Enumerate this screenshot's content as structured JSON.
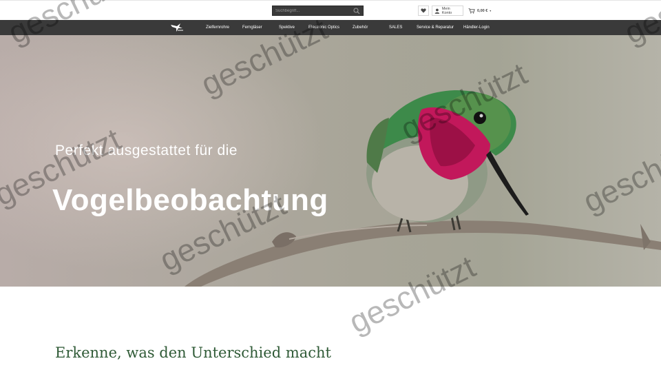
{
  "search": {
    "placeholder": "Suchbegriff..."
  },
  "header": {
    "account_label": "Mein Konto",
    "cart_total": "0,00 €",
    "cart_caret": "▾"
  },
  "nav": {
    "items": [
      {
        "label": "Zielfernrohre"
      },
      {
        "label": "Ferngläser"
      },
      {
        "label": "Spektive"
      },
      {
        "label": "Electronic Optics"
      },
      {
        "label": "Zubehör"
      },
      {
        "label": "SALES"
      },
      {
        "label": "Service & Reparatur"
      },
      {
        "label": "Händler-Login"
      }
    ]
  },
  "hero": {
    "subtitle": "Perfekt ausgestattet für die",
    "title": "Vogelbeobachtung"
  },
  "section": {
    "heading": "Erkenne, was den Unterschied macht"
  },
  "watermark": {
    "text": "geschützt"
  },
  "colors": {
    "nav_bg": "#3a3a3a",
    "heading_green": "#2f5a36",
    "hummingbird_gorget": "#c2185b"
  }
}
